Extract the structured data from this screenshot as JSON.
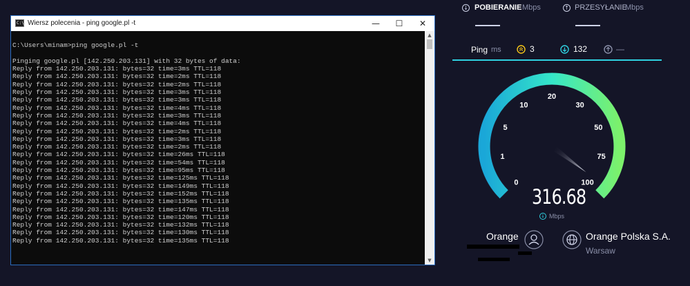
{
  "console_window": {
    "title": "Wiersz polecenia - ping  google.pl -t",
    "icon": "cmd-icon",
    "controls": {
      "minimize": "—",
      "maximize": "☐",
      "close": "✕"
    },
    "lines": [
      "",
      "C:\\Users\\minam>ping google.pl -t",
      "",
      "Pinging google.pl [142.250.203.131] with 32 bytes of data:",
      "Reply from 142.250.203.131: bytes=32 time=3ms TTL=118",
      "Reply from 142.250.203.131: bytes=32 time=2ms TTL=118",
      "Reply from 142.250.203.131: bytes=32 time=2ms TTL=118",
      "Reply from 142.250.203.131: bytes=32 time=3ms TTL=118",
      "Reply from 142.250.203.131: bytes=32 time=3ms TTL=118",
      "Reply from 142.250.203.131: bytes=32 time=4ms TTL=118",
      "Reply from 142.250.203.131: bytes=32 time=3ms TTL=118",
      "Reply from 142.250.203.131: bytes=32 time=4ms TTL=118",
      "Reply from 142.250.203.131: bytes=32 time=2ms TTL=118",
      "Reply from 142.250.203.131: bytes=32 time=3ms TTL=118",
      "Reply from 142.250.203.131: bytes=32 time=2ms TTL=118",
      "Reply from 142.250.203.131: bytes=32 time=26ms TTL=118",
      "Reply from 142.250.203.131: bytes=32 time=54ms TTL=118",
      "Reply from 142.250.203.131: bytes=32 time=95ms TTL=118",
      "Reply from 142.250.203.131: bytes=32 time=125ms TTL=118",
      "Reply from 142.250.203.131: bytes=32 time=149ms TTL=118",
      "Reply from 142.250.203.131: bytes=32 time=152ms TTL=118",
      "Reply from 142.250.203.131: bytes=32 time=135ms TTL=118",
      "Reply from 142.250.203.131: bytes=32 time=147ms TTL=118",
      "Reply from 142.250.203.131: bytes=32 time=120ms TTL=118",
      "Reply from 142.250.203.131: bytes=32 time=132ms TTL=118",
      "Reply from 142.250.203.131: bytes=32 time=130ms TTL=118",
      "Reply from 142.250.203.131: bytes=32 time=135ms TTL=118"
    ]
  },
  "speedtest": {
    "download": {
      "label": "POBIERANIE",
      "unit": "Mbps",
      "icon": "download-icon"
    },
    "upload": {
      "label": "PRZESYŁANIE",
      "unit": "Mbps",
      "icon": "upload-icon"
    },
    "ping": {
      "label": "Ping",
      "unit": "ms",
      "idle_value": "3",
      "idle_icon": "ping-icon",
      "download_value": "132",
      "download_icon": "download-icon",
      "upload_value": "—",
      "upload_icon": "upload-icon"
    },
    "gauge": {
      "ticks": [
        "0",
        "1",
        "5",
        "10",
        "20",
        "30",
        "50",
        "75",
        "100"
      ],
      "speed": "316.68",
      "unit": "Mbps",
      "needle_value": "100+",
      "colors": {
        "start": "#1aa7d8",
        "mid": "#35e6c8",
        "end": "#7cf16b",
        "track": "#1d2038"
      }
    },
    "isp": {
      "name": "Orange",
      "icon": "user-icon"
    },
    "server": {
      "name": "Orange Polska S.A.",
      "location": "Warsaw",
      "icon": "globe-icon"
    },
    "colors": {
      "background": "#141527",
      "accent": "#2fd0e0",
      "text": "#ffffff",
      "muted": "#8a8fa8"
    }
  }
}
